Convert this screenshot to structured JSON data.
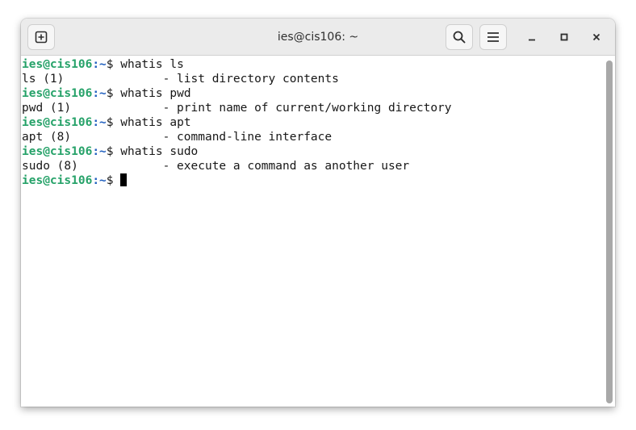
{
  "window": {
    "title": "ies@cis106: ~"
  },
  "terminal": {
    "prompt_user": "ies@cis106",
    "prompt_path": ":~",
    "prompt_symbol": "$",
    "lines": [
      {
        "type": "cmd",
        "command": " whatis ls"
      },
      {
        "type": "out",
        "text": "ls (1)              - list directory contents"
      },
      {
        "type": "cmd",
        "command": " whatis pwd"
      },
      {
        "type": "out",
        "text": "pwd (1)             - print name of current/working directory"
      },
      {
        "type": "cmd",
        "command": " whatis apt"
      },
      {
        "type": "out",
        "text": "apt (8)             - command-line interface"
      },
      {
        "type": "cmd",
        "command": " whatis sudo"
      },
      {
        "type": "out",
        "text": "sudo (8)            - execute a command as another user"
      },
      {
        "type": "cmd",
        "command": " "
      }
    ]
  },
  "icons": {
    "new_tab": "new-tab-icon",
    "search": "search-icon",
    "menu": "hamburger-menu-icon",
    "minimize": "minimize-icon",
    "maximize": "maximize-icon",
    "close": "close-icon"
  },
  "colors": {
    "prompt_user": "#26a269",
    "prompt_path": "#1f5fbf",
    "text": "#171717",
    "titlebar": "#ebebeb"
  }
}
